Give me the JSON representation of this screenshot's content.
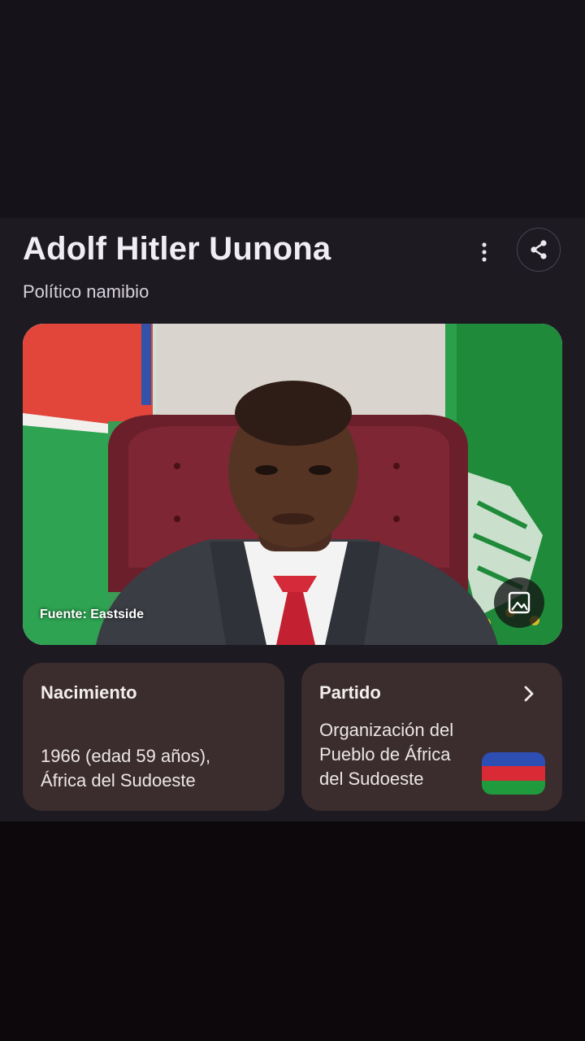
{
  "header": {
    "title": "Adolf Hitler Uunona",
    "subtitle": "Político namibio",
    "more_icon": "more-vertical-icon",
    "share_icon": "share-icon"
  },
  "photo": {
    "source_label": "Fuente: Eastside",
    "gallery_icon": "image-icon"
  },
  "facts": {
    "birth": {
      "label": "Nacimiento",
      "value_line1": "1966 (edad 59 años),",
      "value_line2": "África del Sudoeste"
    },
    "party": {
      "label": "Partido",
      "value_line1": "Organización del",
      "value_line2": "Pueblo de África",
      "value_line3": "del Sudoeste",
      "flag_colors": [
        "#2d4fb4",
        "#d92a35",
        "#1f9a3c"
      ]
    }
  },
  "colors": {
    "card_background": "#1d1a22",
    "fact_card_background": "#3b2c2d",
    "text_primary": "#f1eef3"
  }
}
